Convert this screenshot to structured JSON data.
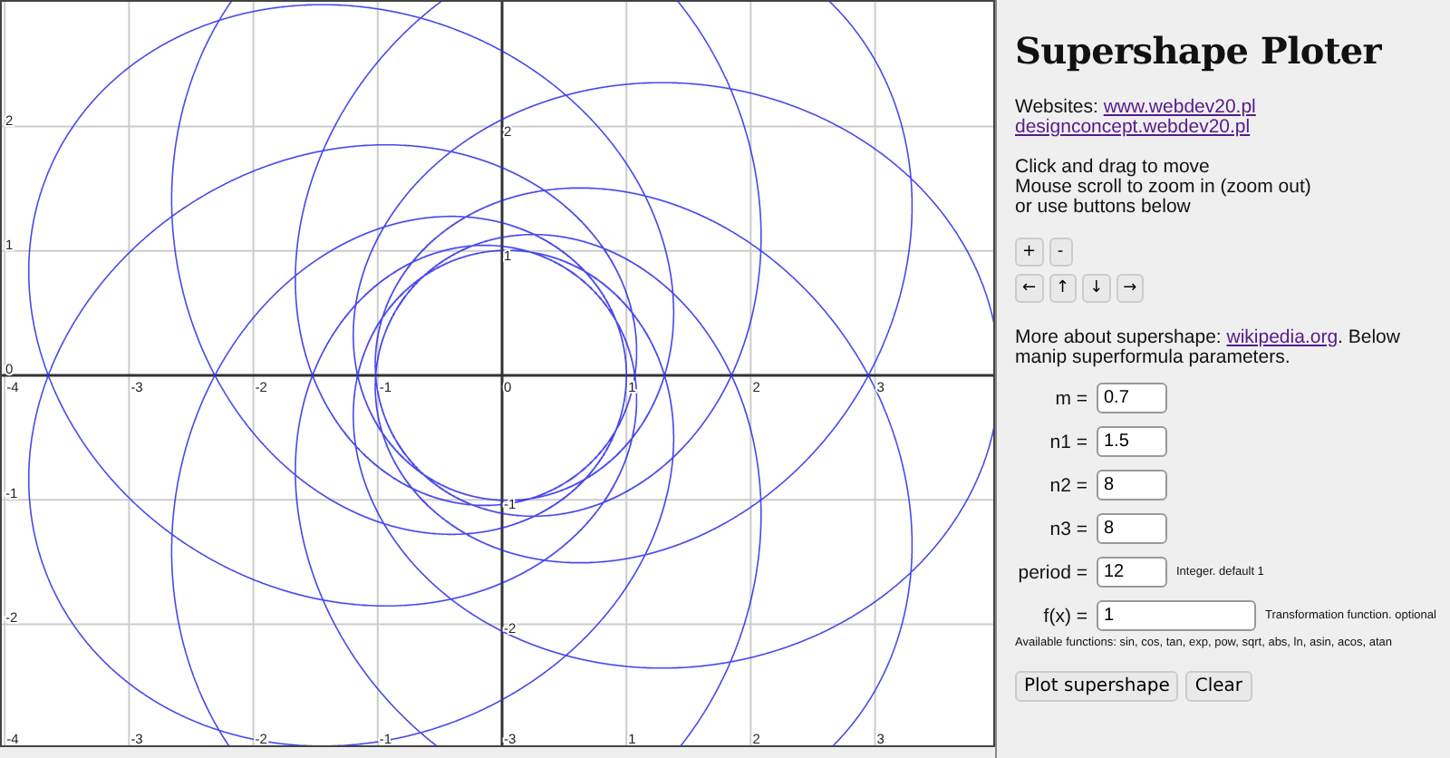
{
  "plot": {
    "x_axis_labels": [
      "-4",
      "-3",
      "-2",
      "-1",
      "0",
      "1",
      "2",
      "3"
    ],
    "y_axis_labels": [
      "2",
      "1",
      "-1",
      "-2",
      "-3"
    ],
    "left_edge_labels": [
      "2",
      "1",
      "0",
      "-1",
      "-2"
    ],
    "bottom_edge_labels": [
      "-4",
      "-3",
      "-2",
      "-1",
      "1",
      "2",
      "3"
    ]
  },
  "sidebar": {
    "title": "Supershape Ploter",
    "websites_label": "Websites:",
    "links": [
      "www.webdev20.pl",
      "designconcept.webdev20.pl"
    ],
    "instructions": [
      "Click and drag to move",
      "Mouse scroll to zoom in (zoom out)",
      "or use buttons below"
    ],
    "zoom_buttons": [
      "+",
      "-"
    ],
    "move_buttons": [
      "←",
      "↑",
      "↓",
      "→"
    ],
    "about_prefix": "More about supershape:",
    "about_link": "wikipedia.org",
    "about_suffix": ". Below manip superformula parameters.",
    "parameters": [
      {
        "label": "m =",
        "value": "0.7",
        "kind": "number"
      },
      {
        "label": "n1 =",
        "value": "1.5",
        "kind": "number"
      },
      {
        "label": "n2 =",
        "value": "8",
        "kind": "number"
      },
      {
        "label": "n3 =",
        "value": "8",
        "kind": "number"
      },
      {
        "label": "period =",
        "value": "12",
        "kind": "number",
        "note": "Integer. default 1"
      },
      {
        "label": "f(x) =",
        "value": "1",
        "kind": "function",
        "note": "Transformation function. optional"
      }
    ],
    "functions_help": "Available functions: sin, cos, tan, exp, pow, sqrt, abs, ln, asin, acos, atan",
    "buttons": [
      "Plot supershape",
      "Clear"
    ]
  }
}
